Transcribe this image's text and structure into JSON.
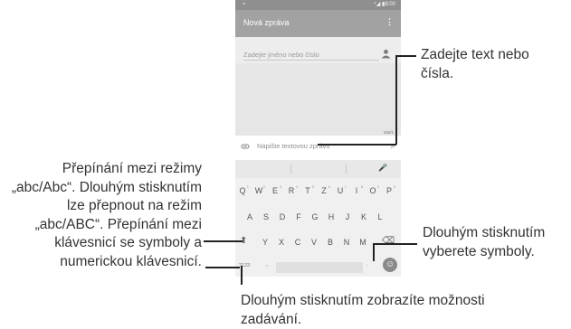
{
  "status": {
    "left": "≈",
    "right": "⁴◢ ▮8:00"
  },
  "app_bar": {
    "title": "Nová zpráva",
    "menu": "⋮"
  },
  "recipient": {
    "placeholder": "Zadejte jméno nebo číslo"
  },
  "messages": {
    "counter": "160/1"
  },
  "compose": {
    "placeholder": "Napište textovou zprávu",
    "send": "➤"
  },
  "keyboard": {
    "row1": [
      {
        "k": "Q",
        "n": "1"
      },
      {
        "k": "W",
        "n": "2"
      },
      {
        "k": "E",
        "n": "3"
      },
      {
        "k": "R",
        "n": "4"
      },
      {
        "k": "T",
        "n": "5"
      },
      {
        "k": "Z",
        "n": "6"
      },
      {
        "k": "U",
        "n": "7"
      },
      {
        "k": "I",
        "n": "8"
      },
      {
        "k": "O",
        "n": "9"
      },
      {
        "k": "P",
        "n": "0"
      }
    ],
    "row2": [
      "A",
      "S",
      "D",
      "F",
      "G",
      "H",
      "J",
      "K",
      "L"
    ],
    "row3": [
      "Y",
      "X",
      "C",
      "V",
      "B",
      "N",
      "M"
    ],
    "shift": "⬆",
    "backspace": "⌫",
    "numbers": "?123",
    "comma": ",",
    "period": ".",
    "mic": "🎤",
    "emoji": "☺"
  },
  "callouts": {
    "text_input": "Zadejte text nebo čísla.",
    "left_group": "Přepínání mezi režimy „abc/Abc“. Dlouhým stisknutím lze přepnout na režim „abc/ABC“. Přepínání mezi klávesnicí se symboly a numerickou klávesnicí.",
    "symbols": "Dlouhým stisknutím vyberete symboly.",
    "options": "Dlouhým stisknutím zobrazíte možnosti zadávání."
  }
}
